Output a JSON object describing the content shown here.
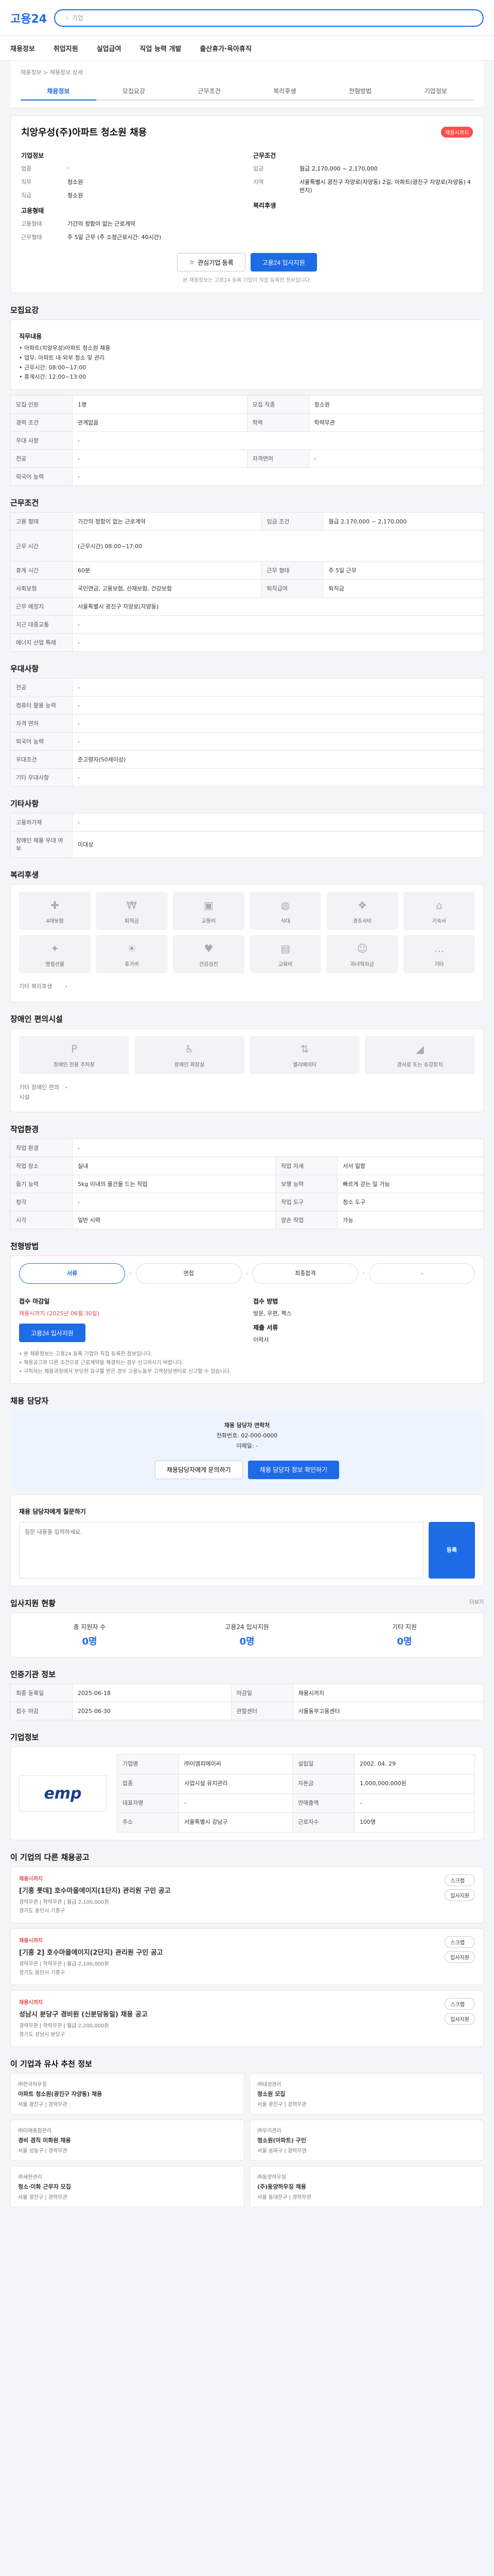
{
  "header": {
    "logo": "고용24",
    "logo_sub": "",
    "search_placeholder": "기업",
    "nav": [
      "채용정보",
      "취업지원",
      "실업급여",
      "직업 능력 개발",
      "출산휴가·육아휴직"
    ]
  },
  "breadcrumb": "채용정보 > 채용정보 상세",
  "tabs": [
    "채용정보",
    "모집요강",
    "근무조건",
    "복리후생",
    "전형방법",
    "기업정보"
  ],
  "job": {
    "badge": "채용시까지",
    "title": "치앙우성(주)아파트 청소원 채용",
    "company_label": "기업정보",
    "left_rows": [
      {
        "k": "업종",
        "v": "-"
      },
      {
        "k": "직무",
        "v": "청소원"
      },
      {
        "k": "직급",
        "v": "청소원"
      }
    ],
    "left_sub": "고용형태",
    "left_rows2": [
      {
        "k": "고용형태",
        "v": "기간의 정함이 없는 근로계약"
      },
      {
        "k": "근무형태",
        "v": "주 5일 근무 (주 소정근로시간: 40시간)"
      }
    ],
    "right_sub": "근무조건",
    "right_rows": [
      {
        "k": "임금",
        "v": "월급 2,170,000 ~ 2,170,000"
      },
      {
        "k": "지역",
        "v": "서울특별시 광진구 자양로(자양동) 2길, 아파트(광진구 자양로(자양동) 4번지)"
      }
    ],
    "right_sub2": "복리후생",
    "interest_button": "관심기업 등록",
    "apply_button": "고용24 입사지원",
    "note": "본 채용정보는 고용24 등록 기업이 직접 등록한 정보입니다."
  },
  "recruit": {
    "title": "모집요강",
    "box_title": "직무내용",
    "box_lines": [
      "• 아파트(치앙우성)아파트 청소원 채용",
      "• 업무: 아파트 내·외부 청소 및 관리",
      "• 근무시간: 08:00~17:00",
      "• 휴게시간: 12:00~13:00"
    ],
    "rows": [
      [
        "모집 인원",
        "1명",
        "모집 직종",
        "청소원"
      ],
      [
        "경력 조건",
        "관계없음",
        "학력",
        "학력무관"
      ],
      [
        "우대 사항",
        "-",
        "",
        ""
      ],
      [
        "전공",
        "-",
        "자격면허",
        "-"
      ],
      [
        "외국어 능력",
        "-",
        "",
        ""
      ]
    ]
  },
  "condition": {
    "title": "근무조건",
    "rows": [
      [
        "고용 형태",
        "기간의 정함이 없는 근로계약",
        "임금 조건",
        "월급 2,170,000 ~ 2,170,000"
      ],
      [
        "근무 시간",
        "(근무시간) 08:00~17:00",
        "",
        ""
      ],
      [
        "휴게 시간",
        "60분",
        "근무 형태",
        "주 5일 근무"
      ],
      [
        "사회보험",
        "국민연금, 고용보험, 산재보험, 건강보험",
        "퇴직급여",
        "퇴직금"
      ],
      [
        "근무 예정지",
        "서울특별시 광진구 자양로(자양동)",
        "",
        ""
      ],
      [
        "지근 대중교통",
        "-",
        "",
        ""
      ],
      [
        "에너지 산업 특례",
        "-",
        "",
        ""
      ]
    ]
  },
  "screening": {
    "title": "우대사항",
    "rows": [
      [
        "전공",
        "-"
      ],
      [
        "컴퓨터 활용 능력",
        "-"
      ],
      [
        "자격 면허",
        "-"
      ],
      [
        "외국어 능력",
        "-"
      ],
      [
        "우대조건",
        "준고령자(50세이상)"
      ],
      [
        "기타 우대사항",
        "-"
      ]
    ]
  },
  "etc": {
    "title": "기타사항",
    "rows": [
      [
        "고용허가제",
        "-"
      ],
      [
        "장애인 채용 우대 여부",
        "미대상"
      ]
    ]
  },
  "welfare": {
    "title": "복리후생",
    "items": [
      "4대보험",
      "퇴직금",
      "교통비",
      "식대",
      "경조사비",
      "기숙사",
      "명절선물",
      "휴가비",
      "건강검진",
      "교육비",
      "자녀학자금",
      "기타"
    ],
    "extra_label": "기타 복리후생",
    "extra_value": "-"
  },
  "facility": {
    "title": "장애인 편의시설",
    "items": [
      "장애인 전용 주차장",
      "장애인 화장실",
      "엘리베이터",
      "경사로 또는 승강장치"
    ],
    "extra_label": "기타 장애인 편의시설",
    "extra_value": "-"
  },
  "work_env": {
    "title": "작업환경",
    "rows": [
      [
        "작업 환경",
        "-",
        "",
        ""
      ],
      [
        "작업 장소",
        "실내",
        "작업 자세",
        "서서 일함"
      ],
      [
        "들기 능력",
        "5kg 이내의 물건을 드는 작업",
        "보행 능력",
        "빠르게 걷는 일 가능"
      ],
      [
        "청각",
        "-",
        "작업 도구",
        "청소 도구"
      ],
      [
        "시각",
        "일반 시력",
        "양손 작업",
        "가능"
      ]
    ]
  },
  "process": {
    "title": "전형방법",
    "steps": [
      "서류",
      "면접",
      "최종합격",
      "-"
    ],
    "deadline_label": "접수 마감일",
    "deadline_value": "채용시까지 (2025년 06월 30일)",
    "method_label": "접수 방법",
    "method_value": "방문, 우편, 팩스",
    "docs_label": "제출 서류",
    "docs_value": "이력서",
    "apply_button": "고용24 입사지원",
    "bullets": [
      "• 본 채용정보는 고용24 등록 기업이 직접 등록한 정보입니다.",
      "• 채용공고와 다른 조건으로 근로계약을 체결하는 경우 신고하시기 바랍니다.",
      "• 구직자는 채용과정에서 부당한 요구를 받은 경우 고용노동부 고객상담센터로 신고할 수 있습니다."
    ]
  },
  "contact": {
    "title": "채용 담당자",
    "line1": "채용 담당자 연락처",
    "line2": "전화번호: 02-000-0000",
    "line3": "이메일: -",
    "btn1": "채용담당자에게 문의하기",
    "btn2": "채용 담당자 정보 확인하기"
  },
  "qa": {
    "title": "채용 담당자에게 질문하기",
    "placeholder": "질문 내용을 입력하세요.",
    "send": "등록"
  },
  "stats": {
    "title": "입사지원 현황",
    "more": "더보기",
    "items": [
      {
        "label": "총 지원자 수",
        "num": "0명"
      },
      {
        "label": "고용24 입사지원",
        "num": "0명"
      },
      {
        "label": "기타 지원",
        "num": "0명"
      }
    ]
  },
  "org": {
    "title": "인증기관 정보",
    "rows": [
      [
        "최종 등록일",
        "2025-06-18",
        "마감일",
        "채용시까지"
      ],
      [
        "접수 마감",
        "2025-06-30",
        "관할센터",
        "서울동부고용센터"
      ]
    ]
  },
  "company": {
    "title": "기업정보",
    "logo_text": "emp",
    "rows": [
      [
        "기업명",
        "㈜이엠피에이씨",
        "설립일",
        "2002. 04. 29"
      ],
      [
        "업종",
        "사업시설 유지관리",
        "자본금",
        "1,000,000,000원"
      ],
      [
        "대표자명",
        "-",
        "연매출액",
        "-"
      ],
      [
        "주소",
        "서울특별시 강남구",
        "근로자수",
        "100명"
      ]
    ]
  },
  "others": {
    "title": "이 기업의 다른 채용공고",
    "jobs": [
      {
        "co": "채용시까지",
        "t": "[기흥 롯데] 호수마을에이지(1단지) 관리원 구인 공고",
        "m": "경력무관 | 학력무관 | 월급 2,100,000원",
        "d": "경기도 용인시 기흥구"
      },
      {
        "co": "채용시까지",
        "t": "[기흥 2] 호수마을에이지(2단지) 관리원 구인 공고",
        "m": "경력무관 | 학력무관 | 월급 2,100,000원",
        "d": "경기도 용인시 기흥구"
      },
      {
        "co": "채용시까지",
        "t": "성남시 분당구 경비원 (신분당동일) 채용 공고",
        "m": "경력무관 | 학력무관 | 월급 2,200,000원",
        "d": "경기도 성남시 분당구"
      }
    ],
    "pill1": "스크랩",
    "pill2": "입사지원"
  },
  "recommend": {
    "title": "이 기업과 유사 추천 정보",
    "items": [
      {
        "tag": "㈜한국하우징",
        "t": "아파트 청소원(광진구 자양동) 채용",
        "m": "서울 광진구 | 경력무관"
      },
      {
        "tag": "㈜대성관리",
        "t": "청소원 모집",
        "m": "서울 광진구 | 경력무관"
      },
      {
        "tag": "㈜미래종합관리",
        "t": "경비 겸직 미화원 채용",
        "m": "서울 성동구 | 경력무관"
      },
      {
        "tag": "㈜우리관리",
        "t": "청소원(아파트) 구인",
        "m": "서울 송파구 | 경력무관"
      },
      {
        "tag": "㈜새한관리",
        "t": "청소·미화 근무자 모집",
        "m": "서울 광진구 | 경력무관"
      },
      {
        "tag": "㈜동양하우징",
        "t": "(주)동양하우징 채용",
        "m": "서울 동대문구 | 경력무관"
      }
    ]
  }
}
